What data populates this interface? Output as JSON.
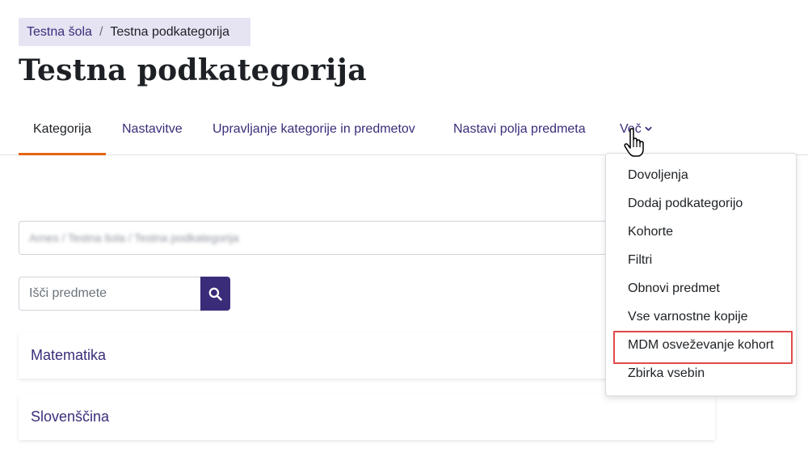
{
  "breadcrumb": {
    "parent": "Testna šola",
    "separator": "/",
    "current": "Testna podkategorija"
  },
  "page_title": "Testna podkategorija",
  "tabs": [
    {
      "label": "Kategorija",
      "active": true
    },
    {
      "label": "Nastavitve",
      "active": false
    },
    {
      "label": "Upravljanje kategorije in predmetov",
      "active": false
    },
    {
      "label": "Nastavi polja predmeta",
      "active": false
    },
    {
      "label": "Več",
      "active": false
    }
  ],
  "category_path": "Arnes / Testna šola / Testna podkategorija",
  "search": {
    "placeholder": "Išči predmete",
    "value": ""
  },
  "courses": [
    {
      "name": "Matematika"
    },
    {
      "name": "Slovenščina"
    }
  ],
  "more_menu": {
    "items": [
      {
        "label": "Dovoljenja"
      },
      {
        "label": "Dodaj podkategorijo"
      },
      {
        "label": "Kohorte"
      },
      {
        "label": "Filtri"
      },
      {
        "label": "Obnovi predmet"
      },
      {
        "label": "Vse varnostne kopije"
      },
      {
        "label": "MDM osveževanje kohort",
        "highlighted": true
      },
      {
        "label": "Zbirka vsebin"
      }
    ]
  },
  "icons": {
    "search": "search-icon",
    "chevron": "chevron-down-icon",
    "cursor": "hand-pointer-icon"
  },
  "colors": {
    "primary": "#3a2c78",
    "link": "#3b2d7a",
    "active_tab_underline": "#e46414",
    "highlight_border": "#e14a4a",
    "breadcrumb_bg": "#e6e3f3"
  }
}
